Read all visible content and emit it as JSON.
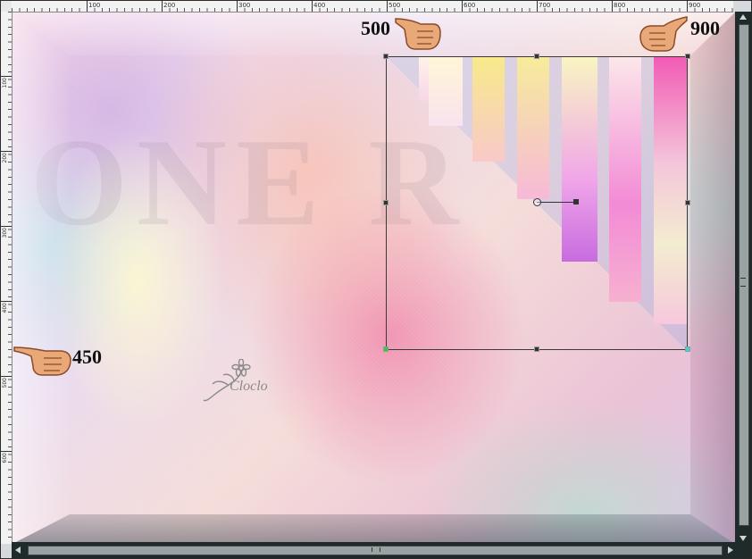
{
  "ruler": {
    "top_labels": [
      "100",
      "200",
      "300",
      "400",
      "500",
      "600",
      "700",
      "800",
      "900"
    ],
    "left_labels": [
      "100",
      "200",
      "300",
      "400",
      "500",
      "600"
    ]
  },
  "annotations": {
    "hand_top_left": {
      "number": "500",
      "icon": "pointing-hand-icon"
    },
    "hand_top_right": {
      "number": "900",
      "icon": "pointing-hand-icon"
    },
    "hand_left": {
      "number": "450",
      "icon": "pointing-hand-icon"
    }
  },
  "watermark": {
    "text": "Cloclo"
  },
  "colors": {
    "handle_green": "#2ecc40",
    "handle_teal": "#38d6d6",
    "scrollbar": "#1f2a2a"
  }
}
